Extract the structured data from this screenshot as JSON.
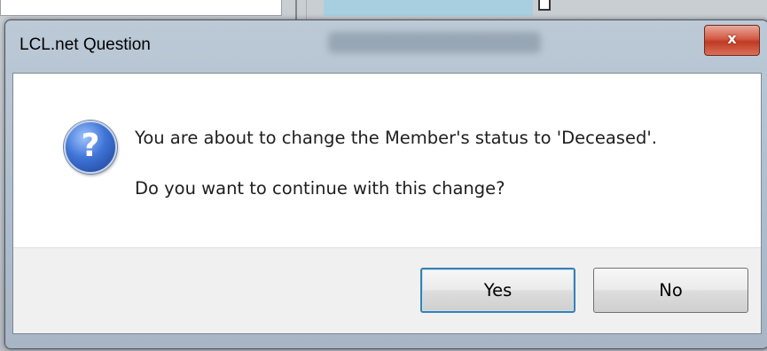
{
  "window": {
    "title": "LCL.net Question",
    "close_symbol": "x"
  },
  "dialog": {
    "icon": "question-icon",
    "icon_glyph": "?",
    "message_line1": "You are about to change the Member's status to 'Deceased'.",
    "message_line2": "Do you want to continue with this change?"
  },
  "buttons": {
    "yes_label": "Yes",
    "no_label": "No"
  },
  "colors": {
    "frame": "#aebdcd",
    "close_button": "#c8442d",
    "default_button_border": "#3c7fb1",
    "footer": "#f0f0f0"
  }
}
